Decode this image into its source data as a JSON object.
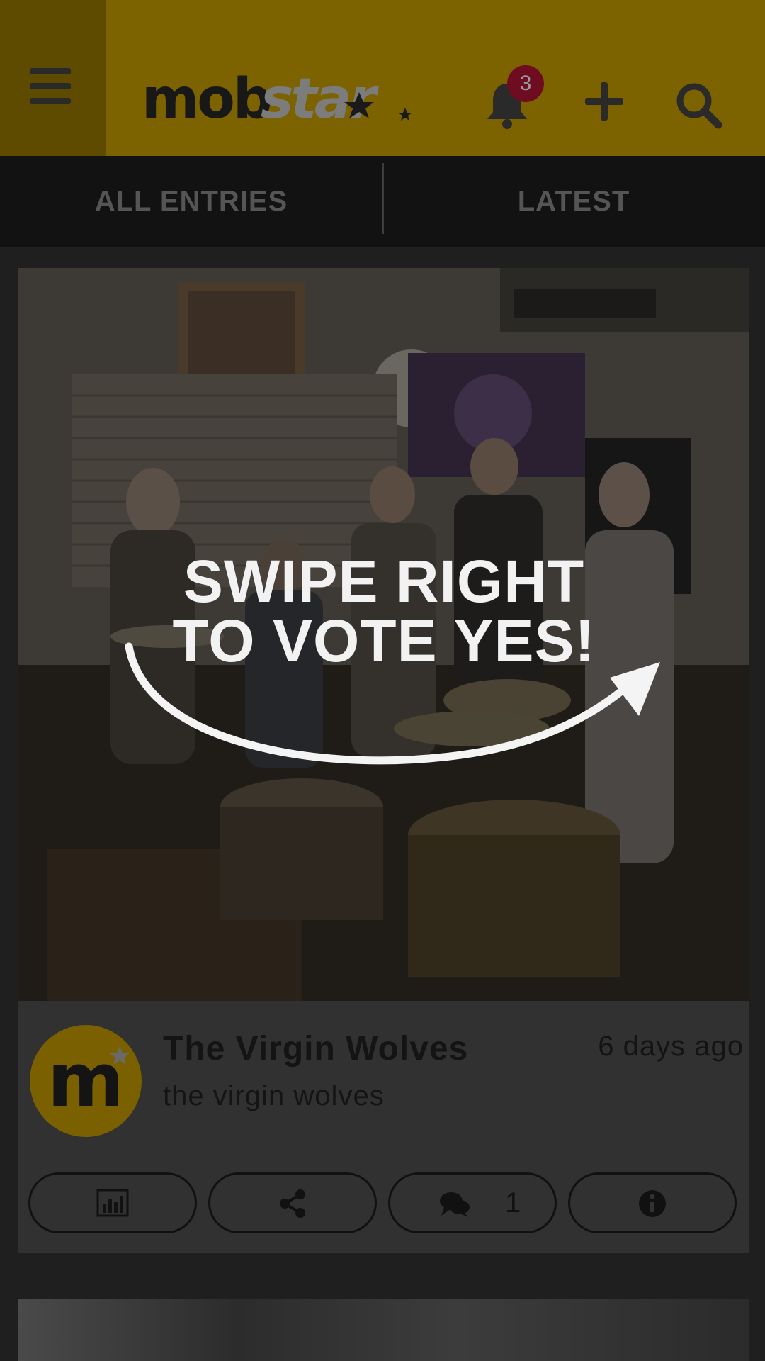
{
  "header": {
    "brand": "mobstar",
    "notification_count": "3",
    "colors": {
      "header_bg": "#7d6300",
      "menu_bg": "#5f4b00",
      "badge": "#6e0d22"
    },
    "icons": [
      "menu-icon",
      "bell-icon",
      "plus-icon",
      "search-icon"
    ]
  },
  "tabs": [
    {
      "label": "ALL ENTRIES"
    },
    {
      "label": "LATEST"
    }
  ],
  "entry": {
    "overlay_line1": "SWIPE RIGHT",
    "overlay_line2": "TO VOTE YES!",
    "title": "The Virgin Wolves",
    "subtitle": "the virgin wolves",
    "time": "6 days ago",
    "comment_count": "1",
    "avatar_letter": "m",
    "actions": [
      "stats-icon",
      "share-icon",
      "comment-icon",
      "info-icon"
    ]
  }
}
